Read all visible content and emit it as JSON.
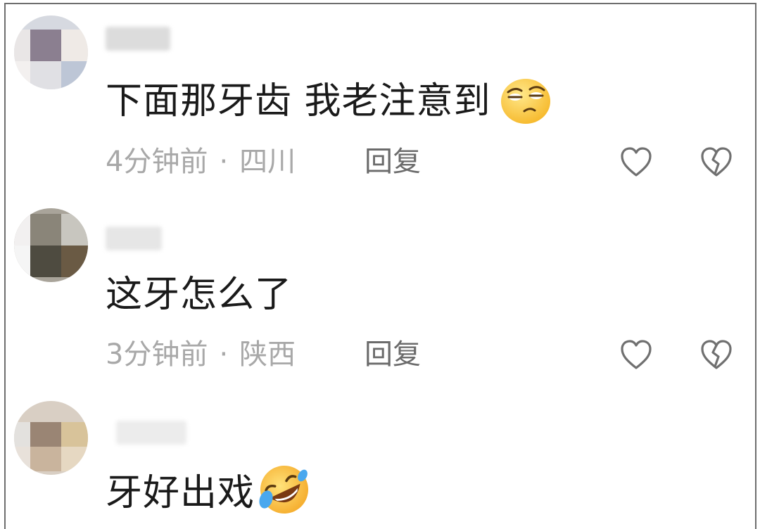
{
  "comments": [
    {
      "text": "下面那牙齿 我老注意到",
      "emoji": "smirk-emoji",
      "time": "4分钟前",
      "location": "四川",
      "separator": "·",
      "reply_label": "回复"
    },
    {
      "text": "这牙怎么了",
      "emoji": "",
      "time": "3分钟前",
      "location": "陕西",
      "separator": "·",
      "reply_label": "回复"
    },
    {
      "text": "牙好出戏",
      "emoji": "rolling-on-floor-laughing-emoji"
    }
  ],
  "icons": {
    "like": "heart-outline-icon",
    "dislike": "broken-heart-icon"
  },
  "colors": {
    "text": "#1a1a1a",
    "meta": "#a8a8a8",
    "reply": "#6b6b6b",
    "icon": "#707070"
  }
}
